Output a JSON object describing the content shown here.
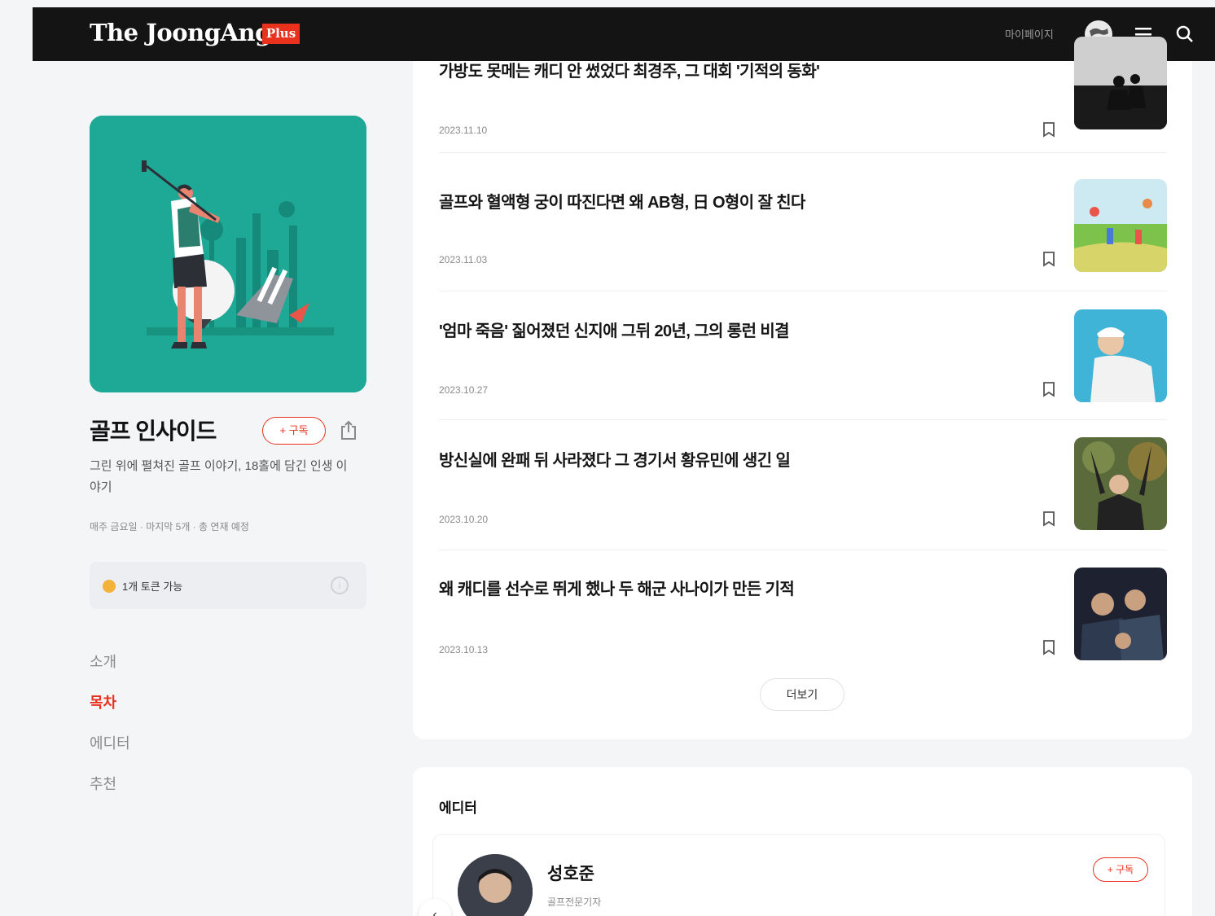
{
  "header": {
    "logo_text": "The JoongAng",
    "logo_badge": "Plus",
    "my_page_label": "마이페이지"
  },
  "series": {
    "title": "골프 인사이드",
    "subscribe_label": "+ 구독",
    "description": "그린 위에 펼쳐진 골프 이야기, 18홀에 담긴 인생 이야기",
    "meta": "매주 금요일 · 마지막 5개 · 총 연재 예정",
    "token_text": "1개 토큰 가능"
  },
  "side_nav": {
    "items": [
      {
        "label": "소개",
        "active": false
      },
      {
        "label": "목차",
        "active": true
      },
      {
        "label": "에디터",
        "active": false
      },
      {
        "label": "추천",
        "active": false
      }
    ]
  },
  "articles": [
    {
      "title": "가방도 못메는 캐디 안 썼었다 최경주, 그 대회 '기적의 동화'",
      "date": "2023.11.10"
    },
    {
      "title": "골프와 혈액형 궁이 따진다면 왜 AB형, 日 O형이 잘 친다",
      "date": "2023.11.03"
    },
    {
      "title": "'엄마 죽음' 짊어졌던 신지애 그뒤 20년, 그의 롱런 비결",
      "date": "2023.10.27"
    },
    {
      "title": "방신실에 완패 뒤 사라졌다 그 경기서 황유민에 생긴 일",
      "date": "2023.10.20"
    },
    {
      "title": "왜 캐디를 선수로 뛰게 했나 두 해군 사나이가 만든 기적",
      "date": "2023.10.13"
    }
  ],
  "more_label": "더보기",
  "editor_section": {
    "heading": "에디터",
    "name": "성호준",
    "role": "골프전문기자",
    "subscribe_label": "+ 구독"
  },
  "colors": {
    "accent": "#e8321e",
    "header_bg": "#141414",
    "cover_bg": "#1ea896",
    "page_bg": "#f4f5f7"
  }
}
